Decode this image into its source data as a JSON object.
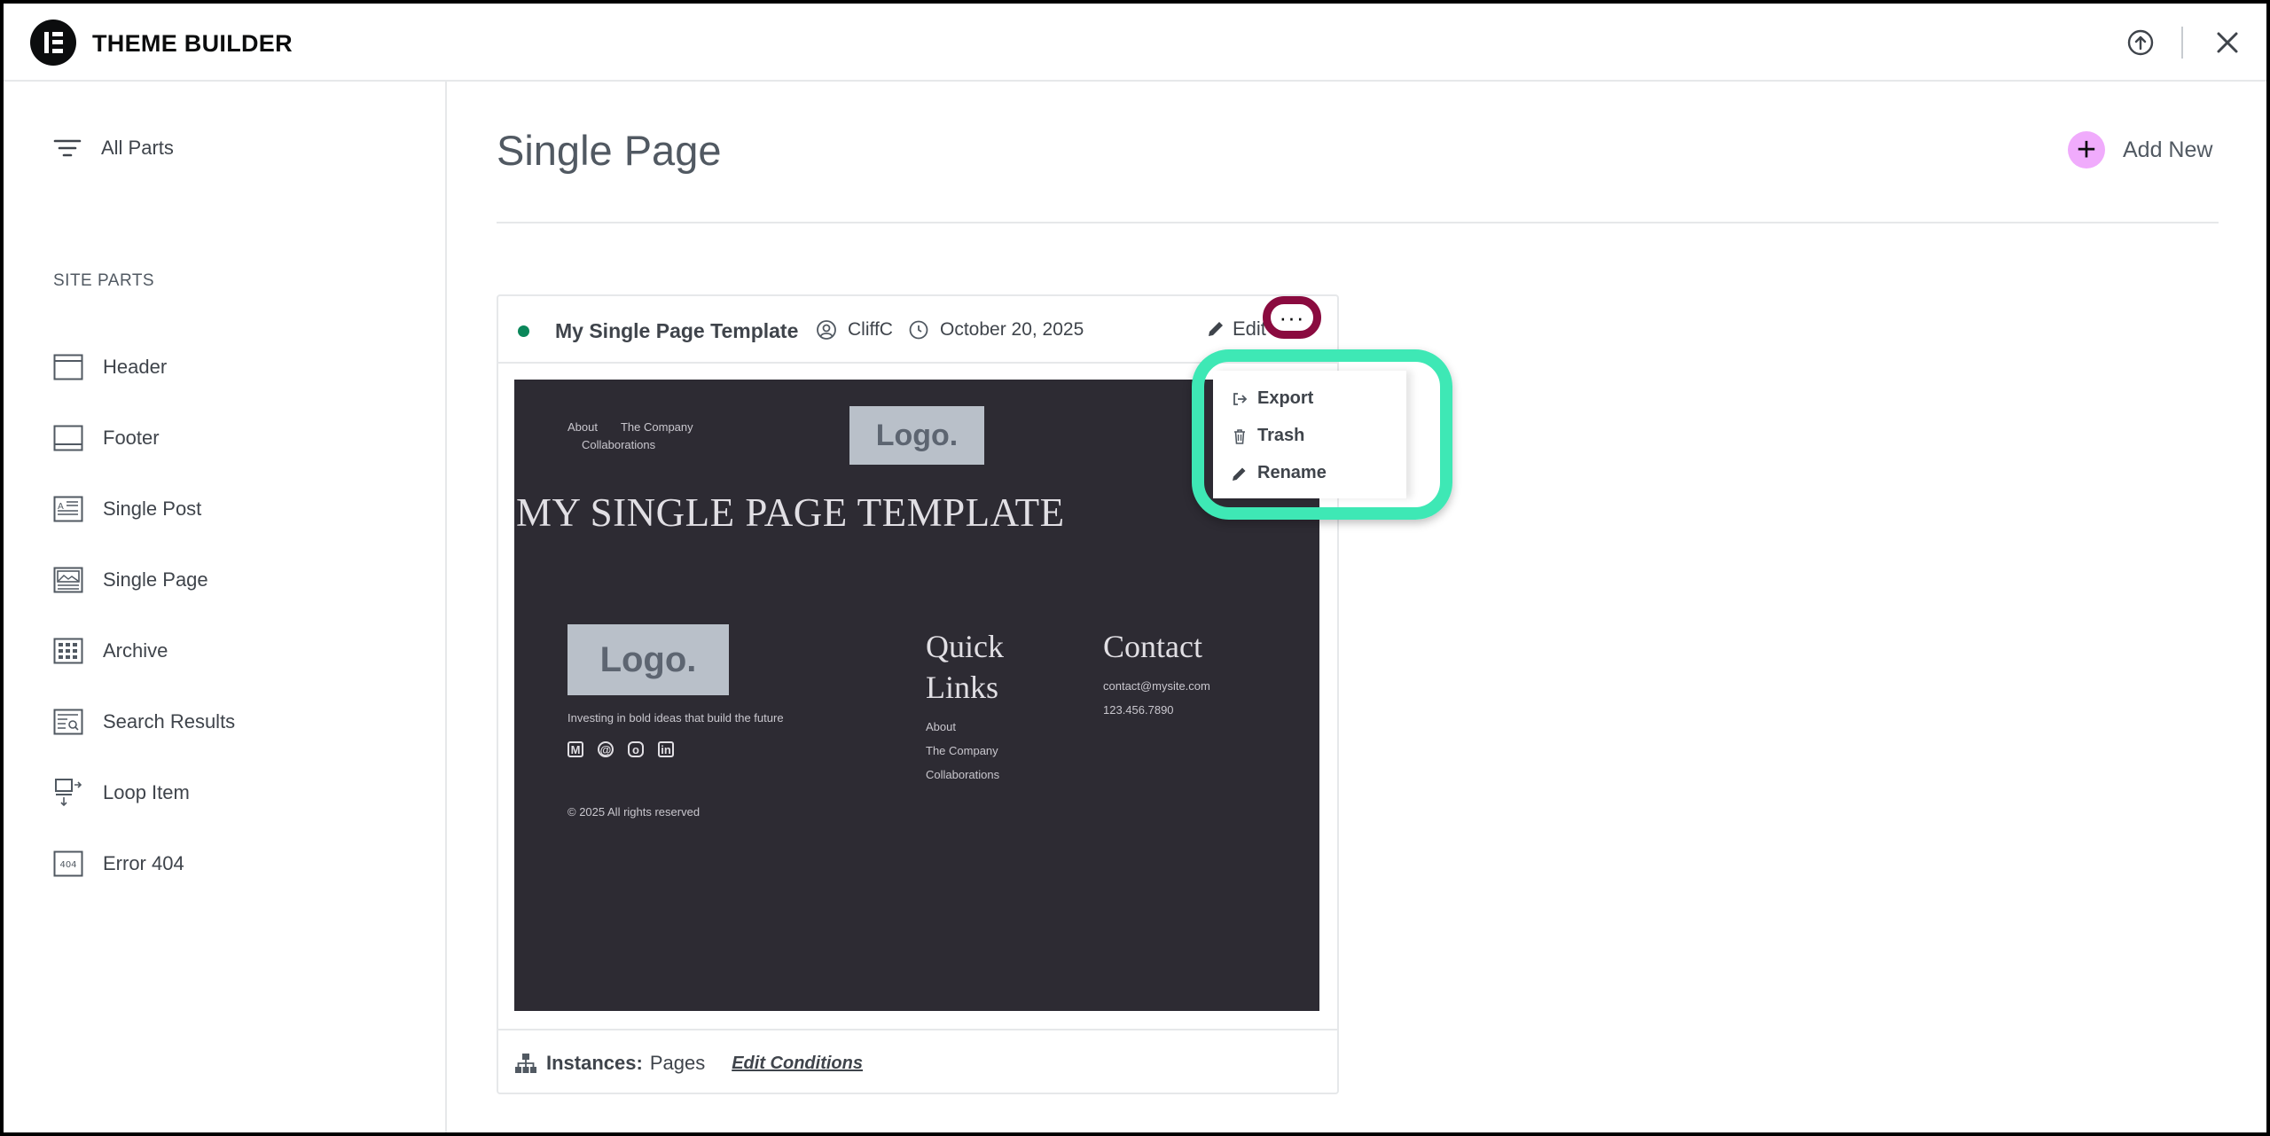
{
  "app": {
    "title": "THEME BUILDER"
  },
  "sidebar": {
    "all_parts_label": "All Parts",
    "section_title": "SITE PARTS",
    "items": [
      {
        "label": "Header",
        "icon": "header-icon"
      },
      {
        "label": "Footer",
        "icon": "footer-icon"
      },
      {
        "label": "Single Post",
        "icon": "single-post-icon"
      },
      {
        "label": "Single Page",
        "icon": "single-page-icon"
      },
      {
        "label": "Archive",
        "icon": "archive-icon"
      },
      {
        "label": "Search Results",
        "icon": "search-results-icon"
      },
      {
        "label": "Loop Item",
        "icon": "loop-item-icon"
      },
      {
        "label": "Error 404",
        "icon": "error-404-icon"
      }
    ]
  },
  "main": {
    "title": "Single Page",
    "add_new_label": "Add New"
  },
  "card": {
    "title": "My Single Page Template",
    "author": "CliffC",
    "date": "October 20, 2025",
    "edit_label": "Edit",
    "more_label": "···",
    "status_color": "#0a875a",
    "instances_label": "Instances:",
    "instances_value": "Pages",
    "edit_conditions_label": "Edit Conditions"
  },
  "preview": {
    "nav_links": [
      "About",
      "The Company",
      "Collaborations"
    ],
    "logo_text": "Logo.",
    "hero_title": "MY SINGLE PAGE TEMPLATE",
    "tagline": "Investing in bold ideas that build the future",
    "copyright": "© 2025 All rights reserved",
    "quick_links_heading_line1": "Quick",
    "quick_links_heading_line2": "Links",
    "quick_links": [
      "About",
      "The Company",
      "Collaborations"
    ],
    "contact_heading": "Contact",
    "contact_email": "contact@mysite.com",
    "contact_phone": "123.456.7890",
    "social_icons": [
      "medium-icon",
      "threads-icon",
      "instagram-icon",
      "linkedin-icon"
    ]
  },
  "menu": {
    "items": [
      {
        "label": "Export",
        "icon": "export-icon"
      },
      {
        "label": "Trash",
        "icon": "trash-icon"
      },
      {
        "label": "Rename",
        "icon": "pencil-icon"
      }
    ]
  },
  "colors": {
    "highlight_more": "#8a0b3f",
    "highlight_menu": "#3ee8b5",
    "add_new_circle": "#f0abfc",
    "preview_bg": "#2d2b33"
  }
}
